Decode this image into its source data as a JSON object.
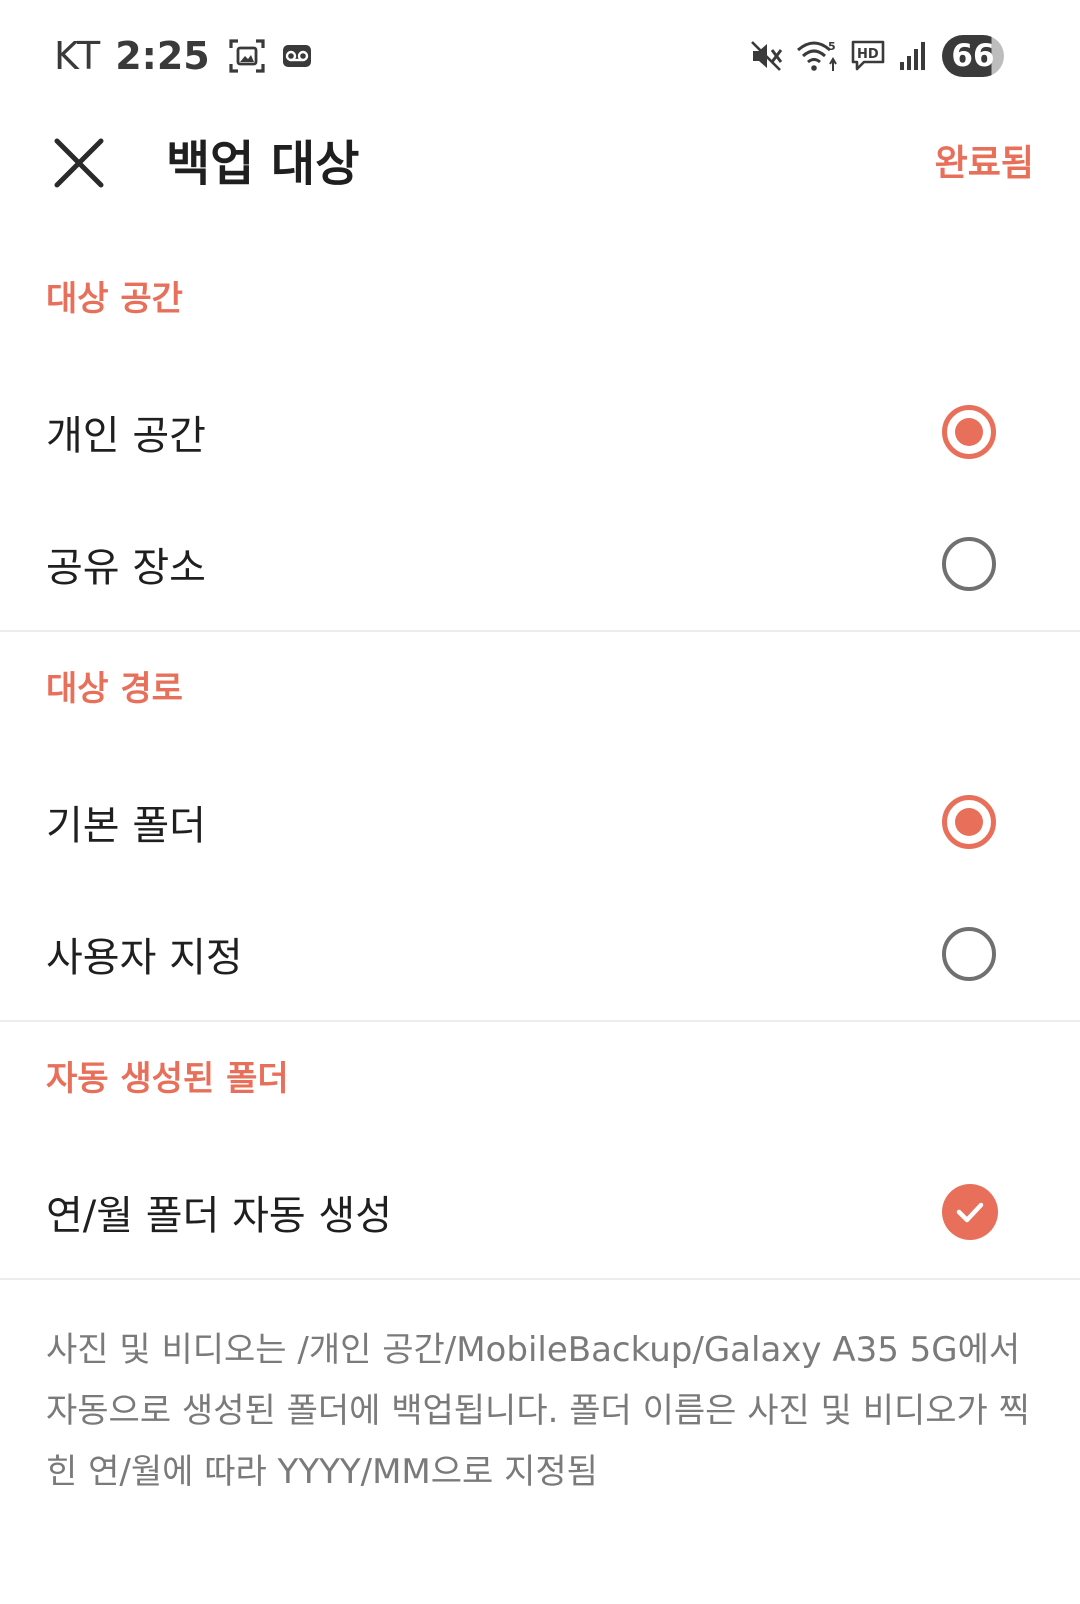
{
  "status_bar": {
    "carrier": "KT",
    "time": "2:25",
    "battery": "66",
    "icons": [
      "screenshot-icon",
      "voicemail-icon",
      "mute-icon",
      "wifi-icon",
      "hd-voice-icon",
      "signal-icon"
    ]
  },
  "app_bar": {
    "title": "백업 대상",
    "done_label": "완료됨",
    "close_icon": "close-icon"
  },
  "sections": {
    "space": {
      "header": "대상 공간",
      "options": [
        {
          "label": "개인 공간",
          "selected": true
        },
        {
          "label": "공유 장소",
          "selected": false
        }
      ]
    },
    "path": {
      "header": "대상 경로",
      "options": [
        {
          "label": "기본 폴더",
          "selected": true
        },
        {
          "label": "사용자 지정",
          "selected": false
        }
      ]
    },
    "auto_folder": {
      "header": "자동 생성된 폴더",
      "option": {
        "label": "연/월 폴더 자동 생성",
        "checked": true
      }
    }
  },
  "description": "사진 및 비디오는 /개인 공간/MobileBackup/Galaxy A35 5G에서 자동으로 생성된 폴더에 백업됩니다. 폴더 이름은 사진 및 비디오가 찍힌 연/월에 따라 YYYY/MM으로 지정됨",
  "colors": {
    "accent": "#e8705a",
    "text": "#1f1f1f",
    "secondary_text": "#7a7a7a",
    "divider": "#ececec"
  }
}
